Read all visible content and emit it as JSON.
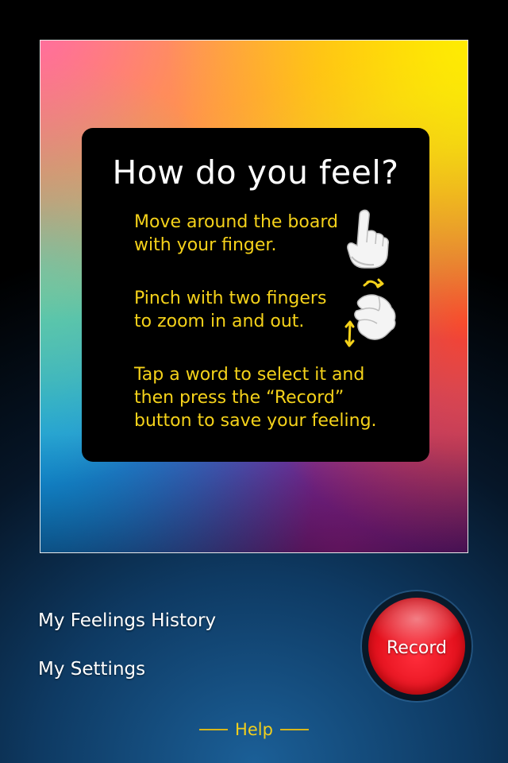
{
  "board": {
    "title": "How do you feel?",
    "steps": [
      {
        "line1": "Move around the board",
        "line2": "with your finger.",
        "icon": "pointing-finger-icon"
      },
      {
        "line1": "Pinch with two fingers",
        "line2": "to zoom in and out.",
        "icon": "pinch-zoom-icon"
      },
      {
        "line1": "Tap a word to select it and",
        "line2": "then press the “Record”",
        "line3": "button to save your feeling."
      }
    ]
  },
  "menu": {
    "history_label": "My Feelings History",
    "settings_label": "My Settings"
  },
  "record": {
    "label": "Record",
    "color": "#e5121e"
  },
  "help": {
    "label": "Help",
    "color": "#f2cf1c"
  },
  "colors": {
    "instruction_text": "#f5d21a",
    "title_text": "#ffffff",
    "panel_bg": "#000000"
  }
}
